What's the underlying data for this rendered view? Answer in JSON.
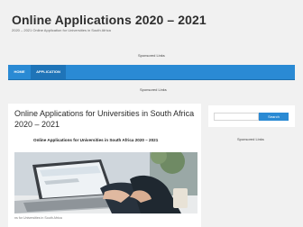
{
  "site": {
    "title": "Online Applications 2020 – 2021",
    "tagline": "2020 – 2021 Online Application for Universities in South Africa"
  },
  "header": {
    "sponsored_label": "Sponsored Links"
  },
  "nav": {
    "items": [
      {
        "label": "HOME"
      },
      {
        "label": "APPLICATION"
      }
    ],
    "colors": {
      "bar": "#2a8ad4",
      "active": "#1f74b8"
    }
  },
  "below_nav": {
    "sponsored_label": "Sponsored Links"
  },
  "article": {
    "title": "Online Applications for Universities in South Africa 2020 – 2021",
    "subtitle": "Online Applications for Universities in South Africa 2020 – 2021",
    "image_icon": "laptop-photo",
    "caption": "ns for Universities in South Africa"
  },
  "sidebar": {
    "search": {
      "placeholder": "",
      "button_label": "Search"
    },
    "sponsored_label": "Sponsored Links"
  }
}
